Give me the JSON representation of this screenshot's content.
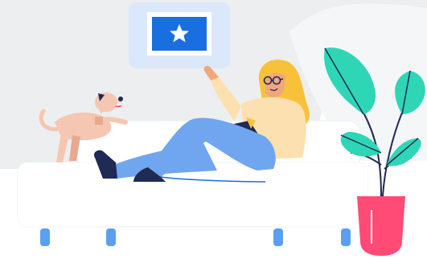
{
  "illustration": {
    "icon": "star-icon",
    "colors": {
      "wall": "#eceef0",
      "wall_light": "#f5f6f7",
      "frame_bg": "#dbe8fb",
      "picture_blue": "#1a6fe0",
      "sofa": "#ffffff",
      "sofa_legs": "#5aa0f0",
      "dog": "#f5c6b1",
      "hair": "#f7c23a",
      "skin": "#f0a77c",
      "sweater": "#fde0b0",
      "jeans": "#6fa6ef",
      "shoe": "#1f2a55",
      "tablet": "#1f2a55",
      "leaf": "#2fd6b5",
      "pot": "#ff4b75"
    }
  }
}
